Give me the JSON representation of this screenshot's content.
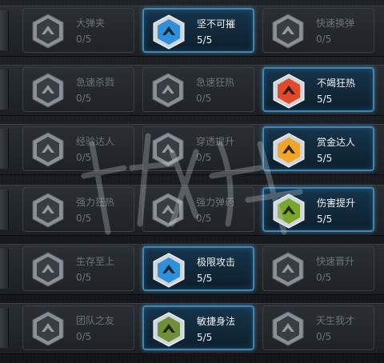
{
  "rows": [
    {
      "cells": [
        {
          "name": "大弹夹",
          "level": "0/5",
          "active": false,
          "icon": "magazine-icon"
        },
        {
          "name": "坚不可摧",
          "level": "5/5",
          "active": true,
          "icon": "shield-bird-icon",
          "color": "#2f8fd8"
        },
        {
          "name": "快速换弹",
          "level": "0/5",
          "active": false,
          "icon": "hand-reload-icon"
        }
      ]
    },
    {
      "cells": [
        {
          "name": "急速杀戮",
          "level": "0/5",
          "active": false,
          "icon": "fist-icon"
        },
        {
          "name": "急速狂热",
          "level": "0/5",
          "active": false,
          "icon": "speed-swirl-icon"
        },
        {
          "name": "不竭狂热",
          "level": "5/5",
          "active": true,
          "icon": "skull-fire-icon",
          "color": "#e0492a"
        }
      ]
    },
    {
      "cells": [
        {
          "name": "经验达人",
          "level": "0/5",
          "active": false,
          "icon": "xp-up-icon"
        },
        {
          "name": "穿透提升",
          "level": "0/5",
          "active": false,
          "icon": "penetration-icon"
        },
        {
          "name": "赏金达人",
          "level": "5/5",
          "active": true,
          "icon": "gold-coin-icon",
          "color": "#f0a52a"
        }
      ]
    },
    {
      "cells": [
        {
          "name": "强力狂热",
          "level": "0/5",
          "active": false,
          "icon": "power-frenzy-icon"
        },
        {
          "name": "强力弹药",
          "level": "0/5",
          "active": false,
          "icon": "power-ammo-icon"
        },
        {
          "name": "伤害提升",
          "level": "5/5",
          "active": true,
          "icon": "damage-gun-icon",
          "color": "#7aa62e"
        }
      ]
    },
    {
      "cells": [
        {
          "name": "生存至上",
          "level": "0/5",
          "active": false,
          "icon": "medic-cross-icon"
        },
        {
          "name": "极限攻击",
          "level": "5/5",
          "active": true,
          "icon": "extreme-attack-icon",
          "color": "#2f8fd8"
        },
        {
          "name": "快速晋升",
          "level": "0/5",
          "active": false,
          "icon": "rank-star-icon"
        }
      ]
    },
    {
      "cells": [
        {
          "name": "团队之友",
          "level": "0/5",
          "active": false,
          "icon": "team-gun-icon"
        },
        {
          "name": "敏捷身法",
          "level": "5/5",
          "active": true,
          "icon": "agile-soldier-icon",
          "color": "#6f8f3a"
        },
        {
          "name": "天生我才",
          "level": "0/5",
          "active": false,
          "icon": "eye-icon"
        }
      ]
    }
  ]
}
